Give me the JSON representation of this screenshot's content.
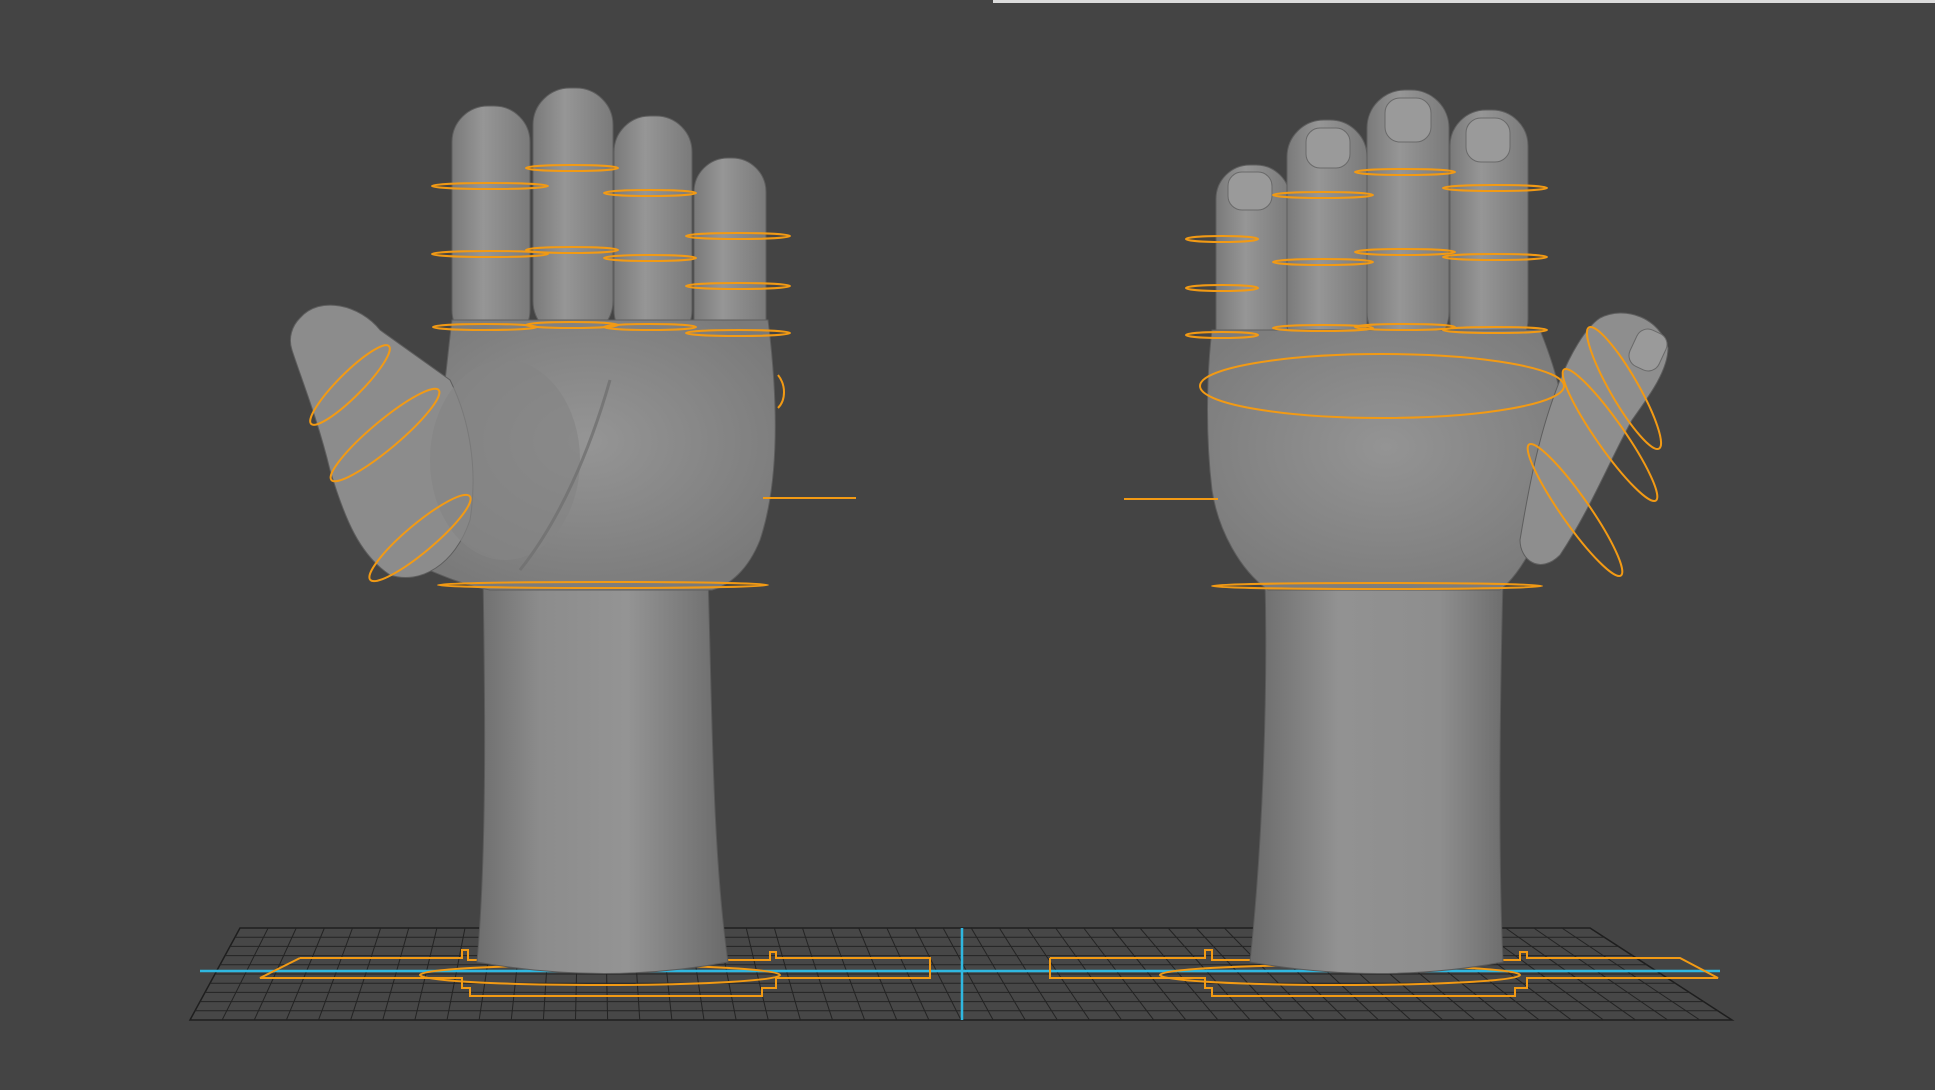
{
  "viewport": {
    "background_color": "#444444",
    "mesh_color": "#8a8a8a",
    "control_curve_color": "#f29a14",
    "grid_axis_color": "#2fb7e0",
    "grid_line_color": "#1e1e1e"
  },
  "scene_objects": [
    {
      "name": "left-hand-mesh",
      "view": "palm"
    },
    {
      "name": "right-hand-mesh",
      "view": "back"
    }
  ]
}
